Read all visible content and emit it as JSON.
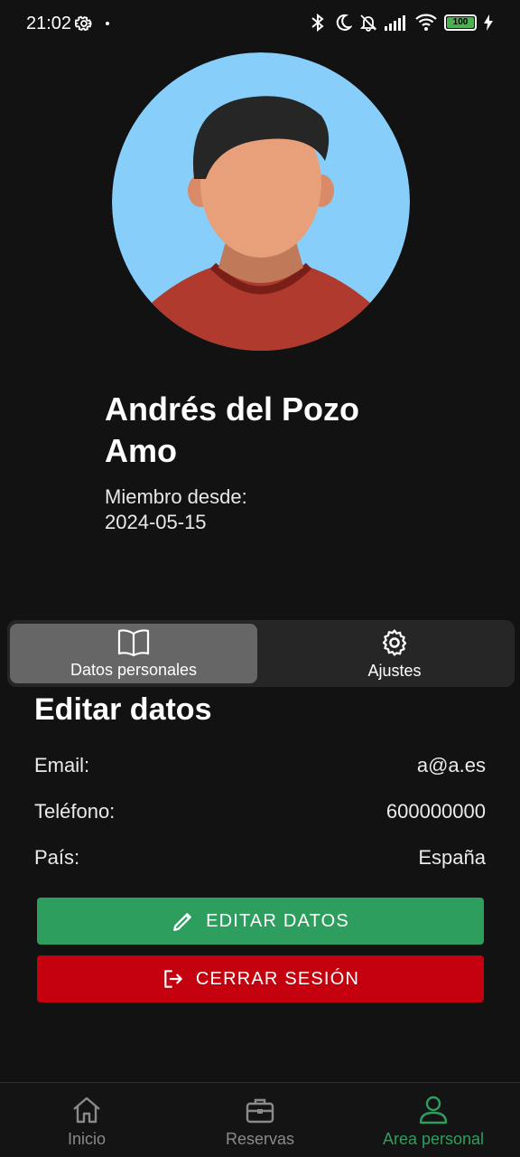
{
  "status_bar": {
    "time": "21:02",
    "battery": "100",
    "icons": [
      "settings-icon",
      "bluetooth-icon",
      "moon-icon",
      "bell-off-icon",
      "signal-icon",
      "wifi-icon",
      "battery-icon",
      "charging-icon"
    ]
  },
  "profile": {
    "name": "Andrés del Pozo Amo",
    "member_label": "Miembro desde:",
    "member_date": "2024-05-15"
  },
  "tabs": [
    {
      "label": "Datos personales",
      "icon": "book-icon",
      "active": true
    },
    {
      "label": "Ajustes",
      "icon": "gear-icon",
      "active": false
    }
  ],
  "edit_section": {
    "title": "Editar datos",
    "fields": [
      {
        "label": "Email:",
        "value": "a@a.es"
      },
      {
        "label": "Teléfono:",
        "value": "600000000"
      },
      {
        "label": "País:",
        "value": "España"
      }
    ],
    "edit_button": "EDITAR DATOS",
    "logout_button": "CERRAR SESIÓN"
  },
  "bottom_nav": [
    {
      "label": "Inicio",
      "icon": "home-icon",
      "active": false
    },
    {
      "label": "Reservas",
      "icon": "briefcase-icon",
      "active": false
    },
    {
      "label": "Area personal",
      "icon": "person-icon",
      "active": true
    }
  ],
  "colors": {
    "background": "#121212",
    "accent_green": "#2e9e5f",
    "danger_red": "#c4000e",
    "tab_active": "#666666",
    "tab_bar": "#262626"
  }
}
